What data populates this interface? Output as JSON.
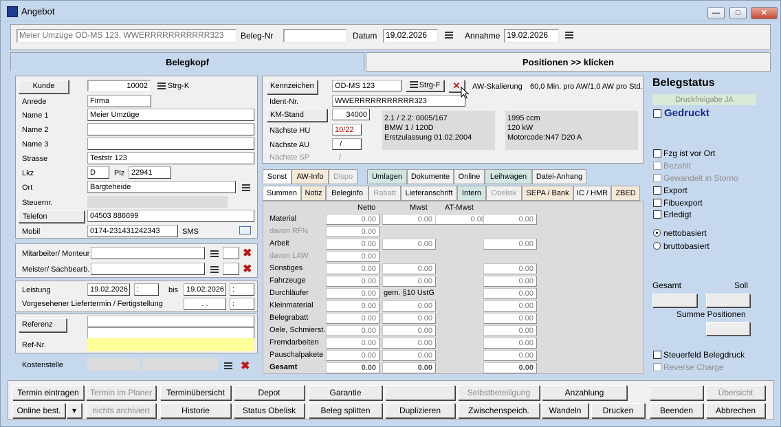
{
  "window": {
    "title": "Angebot"
  },
  "topbar": {
    "customer": "Meier Umzüge OD-MS 123, WWERRRRRRRRRRR323",
    "beleg_label": "Beleg-Nr",
    "beleg_value": "",
    "datum_label": "Datum",
    "datum_value": "19.02.2026",
    "annahme_label": "Annahme",
    "annahme_value": "19.02.2026"
  },
  "tabs": {
    "belegkopf": "Belegkopf",
    "positionen": "Positionen >> klicken"
  },
  "customer": {
    "kunde_btn": "Kunde",
    "kunde_value": "10002",
    "strg_k": "Strg-K",
    "anrede_label": "Anrede",
    "anrede_value": "Firma",
    "name1_label": "Name 1",
    "name1_value": "Meier Umzüge",
    "name2_label": "Name 2",
    "name2_value": "",
    "name3_label": "Name 3",
    "name3_value": "",
    "strasse_label": "Strasse",
    "strasse_value": "Teststr 123",
    "lkz_label": "Lkz",
    "lkz_value": "D",
    "plz_label": "Plz",
    "plz_value": "22941",
    "ort_label": "Ort",
    "ort_value": "Bargteheide",
    "steuer_label": "Steuernr.",
    "steuer_value": "",
    "telefon_btn": "Telefon",
    "telefon_value": "04503 886699",
    "mobil_label": "Mobil",
    "mobil_value": "0174-231431242343",
    "sms": "SMS"
  },
  "staff": {
    "mitarbeiter_label": "Mitarbeiter/ Monteur",
    "meister_label": "Meister/ Sachbearb."
  },
  "leistung": {
    "label": "Leistung",
    "from": "19.02.2026",
    "from_time": ":",
    "bis": "bis",
    "to": "19.02.2026",
    "to_time": ":",
    "liefer_label": "Vorgesehener Liefertermin / Fertigstellung",
    "liefer_date": ". .",
    "liefer_time": ":"
  },
  "ref": {
    "referenz_btn": "Referenz",
    "refnr_label": "Ref-Nr.",
    "kosten_label": "Kostenstelle"
  },
  "vehicle": {
    "kennzeichen_btn": "Kennzeichen",
    "kennzeichen_value": "OD-MS 123",
    "strg_f": "Strg-F",
    "aw_label": "AW-Skalierung",
    "aw_value": "60,0 Min. pro AW/1,0 AW pro Std.",
    "ident_label": "Ident-Nr.",
    "ident_value": "WWERRRRRRRRRRR323",
    "km_btn": "KM-Stand",
    "km_value": "34000",
    "hu_label": "Nächste HU",
    "hu_value": "10/22",
    "au_label": "Nächste AU",
    "au_value": "/",
    "sp_label": "Nächste SP",
    "sp_value": "/",
    "info1": [
      "2.1 / 2.2: 0005/167",
      "BMW 1 / 120D",
      "Erstzulassung 01.02.2004"
    ],
    "info2": [
      "1995 ccm",
      "120 kW",
      "Motorcode:N47 D20 A"
    ]
  },
  "tabs_row1": [
    "Sonst",
    "AW-Info",
    "Dispo",
    "Umlagen",
    "Dokumente",
    "Online",
    "Leihwagen",
    "Datei-Anhang"
  ],
  "tabs_row2": [
    "Summen",
    "Notiz",
    "Beleginfo",
    "Rabatt",
    "Lieferanschrift",
    "Intern",
    "Obelisk",
    "SEPA / Bank",
    "IC / HMR",
    "ZBED"
  ],
  "summen": {
    "col_netto": "Netto",
    "col_mwst": "Mwst",
    "col_at": "AT-Mwst",
    "rows": [
      {
        "label": "Material",
        "netto": "0.00",
        "mwst": "0.00",
        "at": "0.00",
        "total": "0.00"
      },
      {
        "label": "davon RFN",
        "netto": "0.00"
      },
      {
        "label": "Arbeit",
        "netto": "0.00",
        "mwst": "0.00",
        "total": "0.00"
      },
      {
        "label": "davon LAW",
        "netto": "0.00"
      },
      {
        "label": "Sonstiges",
        "netto": "0.00",
        "mwst": "0.00",
        "total": "0.00"
      },
      {
        "label": "Fahrzeuge",
        "netto": "0.00",
        "mwst": "0.00",
        "total": "0.00"
      },
      {
        "label": "Durchläufer",
        "netto": "0.00",
        "note": "gem. §10 UstG",
        "total": "0.00"
      },
      {
        "label": "Kleinmaterial",
        "netto": "0.00",
        "mwst": "0.00",
        "total": "0.00"
      },
      {
        "label": "Belegrabatt",
        "netto": "0.00",
        "mwst": "0.00",
        "total": "0.00"
      },
      {
        "label": "Oele, Schmierst.",
        "netto": "0.00",
        "mwst": "0.00",
        "total": "0.00"
      },
      {
        "label": "Fremdarbeiten",
        "netto": "0.00",
        "mwst": "0.00",
        "total": "0.00"
      },
      {
        "label": "Pauschalpakete",
        "netto": "0.00",
        "mwst": "0.00",
        "total": "0.00"
      },
      {
        "label": "Gesamt",
        "netto": "0.00",
        "mwst": "0.00",
        "total": "0.00"
      }
    ]
  },
  "status": {
    "title": "Belegstatus",
    "druckfreigabe": "Druckfreigabe JA",
    "gedruckt": "Gedruckt",
    "checks": [
      "Fzg ist vor Ort",
      "Bezahlt",
      "Gewandelt in Storno",
      "Export",
      "Fibuexport",
      "Erledigt"
    ],
    "netto": "nettobasiert",
    "brutto": "bruttobasiert",
    "gesamt": "Gesamt",
    "soll": "Soll",
    "summe_pos": "Summe Positionen",
    "steuerfeld": "Steuerfeld Belegdruck",
    "reverse": "Reverse Charge"
  },
  "buttons_row1": [
    "Termin eintragen",
    "Termin im Planer",
    "Terminübersicht",
    "Depot",
    "Garantie",
    "",
    "Selbstbeteiligung",
    "Anzahlung",
    "",
    "Übersicht"
  ],
  "buttons_row2": [
    "Online best.",
    "nichts archiviert",
    "Historie",
    "Status Obelisk",
    "Beleg splitten",
    "Duplizieren",
    "Zwischenspeich.",
    "Wandeln",
    "Drucken",
    "Beenden",
    "Abbrechen"
  ]
}
